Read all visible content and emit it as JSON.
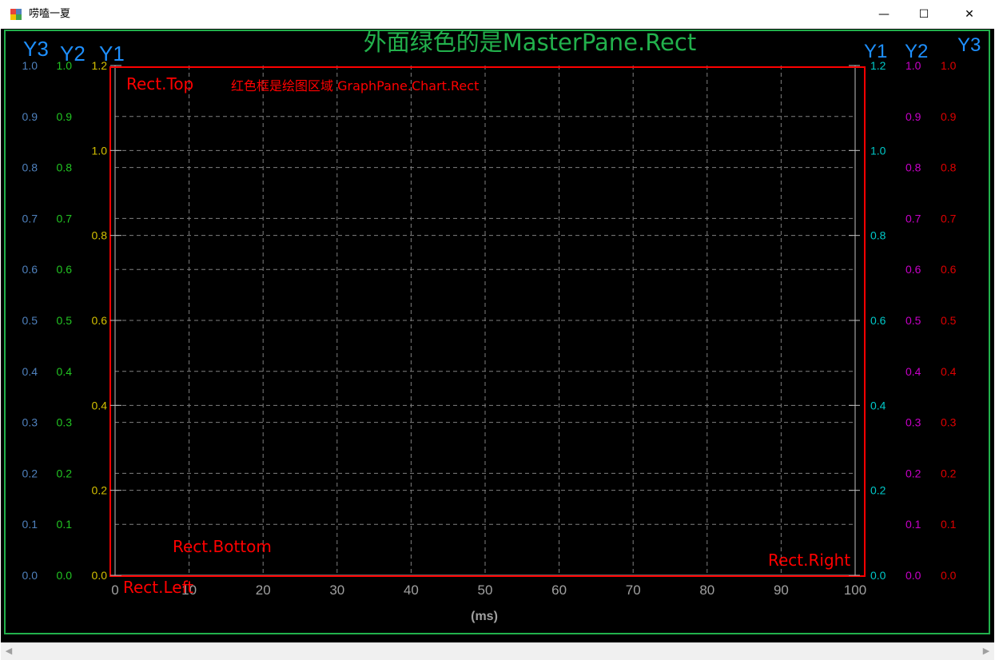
{
  "window": {
    "title": "唠嗑一夏",
    "minimize_glyph": "—",
    "maximize_glyph": "☐",
    "close_glyph": "✕"
  },
  "chart": {
    "title": "外面绿色的是MasterPane.Rect",
    "annotations": {
      "chart_rect": "红色框是绘图区域 GraphPane.Chart.Rect",
      "rect_top": "Rect.Top",
      "rect_bottom": "Rect.Bottom",
      "rect_left": "Rect.Left",
      "rect_right": "Rect.Right"
    },
    "axis_titles": {
      "left_y3": "Y3",
      "left_y2": "Y2",
      "left_y1": "Y1",
      "right_y1": "Y1",
      "right_y2": "Y2",
      "right_y3": "Y3",
      "x": "(ms)"
    }
  },
  "colors": {
    "master_pane_border": "#22b14c",
    "chart_rect_border": "#ff0000",
    "background": "#000000",
    "grid": "#808080",
    "y3_left": "#4f81bd",
    "y2_left": "#22c422",
    "y1_left": "#d4c000",
    "y1_right": "#00c8c8",
    "y2_right": "#c800c8",
    "y3_right": "#e00000",
    "x_axis": "#a0a0a0",
    "title_green": "#22b14c",
    "label_blue": "#1e90ff"
  },
  "chart_data": {
    "type": "line",
    "series": [],
    "x_axis": {
      "label": "(ms)",
      "range": [
        0,
        100
      ],
      "ticks": [
        0,
        10,
        20,
        30,
        40,
        50,
        60,
        70,
        80,
        90,
        100
      ]
    },
    "y_axes": [
      {
        "name": "Y3",
        "side": "left",
        "range": [
          0,
          1
        ],
        "ticks": [
          "0.0",
          "0.1",
          "0.2",
          "0.3",
          "0.4",
          "0.5",
          "0.6",
          "0.7",
          "0.8",
          "0.9",
          "1.0"
        ]
      },
      {
        "name": "Y2",
        "side": "left",
        "range": [
          0,
          1
        ],
        "ticks": [
          "0.0",
          "0.1",
          "0.2",
          "0.3",
          "0.4",
          "0.5",
          "0.6",
          "0.7",
          "0.8",
          "0.9",
          "1.0"
        ]
      },
      {
        "name": "Y1",
        "side": "left",
        "range": [
          0,
          1.2
        ],
        "ticks": [
          "0.0",
          "0.2",
          "0.4",
          "0.6",
          "0.8",
          "1.0",
          "1.2"
        ]
      },
      {
        "name": "Y1",
        "side": "right",
        "range": [
          0,
          1.2
        ],
        "ticks": [
          "0.0",
          "0.2",
          "0.4",
          "0.6",
          "0.8",
          "1.0",
          "1.2"
        ]
      },
      {
        "name": "Y2",
        "side": "right",
        "range": [
          0,
          1
        ],
        "ticks": [
          "0.0",
          "0.1",
          "0.2",
          "0.3",
          "0.4",
          "0.5",
          "0.6",
          "0.7",
          "0.8",
          "0.9",
          "1.0"
        ]
      },
      {
        "name": "Y3",
        "side": "right",
        "range": [
          0,
          1
        ],
        "ticks": [
          "0.0",
          "0.1",
          "0.2",
          "0.3",
          "0.4",
          "0.5",
          "0.6",
          "0.7",
          "0.8",
          "0.9",
          "1.0"
        ]
      }
    ],
    "grid": true
  }
}
